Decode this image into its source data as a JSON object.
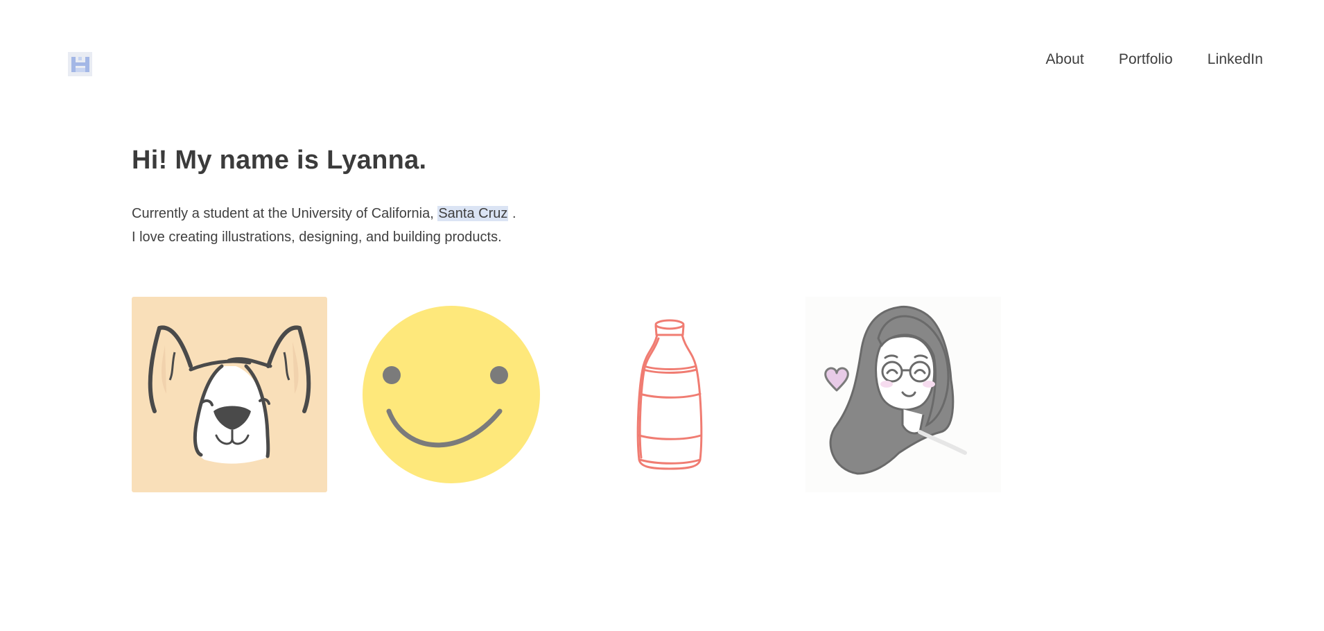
{
  "header": {
    "logo": "logo-icon",
    "nav": [
      "About",
      "Portfolio",
      "LinkedIn"
    ]
  },
  "intro": {
    "title": "Hi! My name is Lyanna.",
    "line1_prefix": "Currently a student at the University of California,",
    "line1_highlight": "Santa Cruz",
    "line1_suffix": ".",
    "line2": "I love creating illustrations, designing, and building products."
  },
  "gallery": {
    "items": [
      {
        "icon": "corgi-illustration",
        "background": "#f9dfb9"
      },
      {
        "icon": "smiley-face-illustration",
        "background": "#fee87b"
      },
      {
        "icon": "milk-bottle-illustration",
        "color": "#f07c72"
      },
      {
        "icon": "self-portrait-illustration",
        "accent": "#e8cbe7"
      }
    ]
  },
  "colors": {
    "text": "#3f3f3f",
    "highlight": "#dbe4f4",
    "logo_blue": "#a3b7e6"
  }
}
